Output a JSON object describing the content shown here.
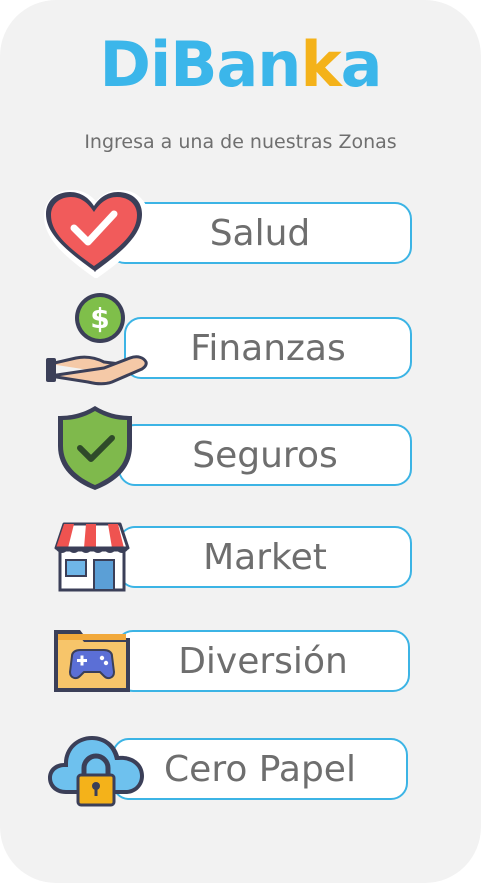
{
  "brand": {
    "part1": "DiBan",
    "part2": "k",
    "part3": "a"
  },
  "subtitle": "Ingresa a una de nuestras Zonas",
  "zones": [
    {
      "label": "Salud",
      "icon": "heart-check-icon"
    },
    {
      "label": "Finanzas",
      "icon": "hand-coin-icon"
    },
    {
      "label": "Seguros",
      "icon": "shield-check-icon"
    },
    {
      "label": "Market",
      "icon": "store-icon"
    },
    {
      "label": "Diversión",
      "icon": "game-folder-icon"
    },
    {
      "label": "Cero Papel",
      "icon": "cloud-lock-icon"
    }
  ],
  "colors": {
    "primary": "#3bb6ea",
    "accent": "#f4b21a",
    "border": "#3cb4e5",
    "text": "#6e6e6e"
  }
}
